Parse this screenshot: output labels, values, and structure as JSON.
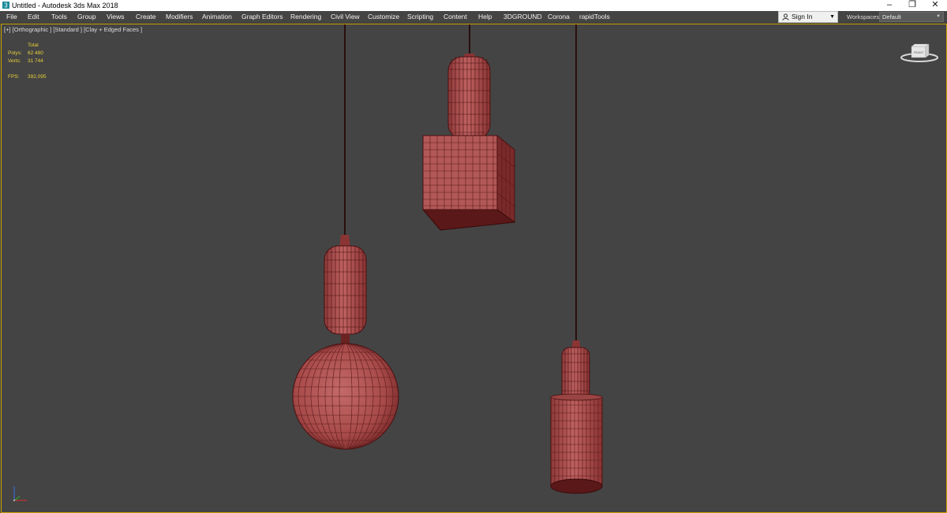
{
  "window": {
    "title": "Untitled - Autodesk 3ds Max 2018",
    "buttons": [
      "–",
      "❐",
      "✕"
    ]
  },
  "menu": {
    "items": [
      "File",
      "Edit",
      "Tools",
      "Group",
      "Views",
      "Create",
      "Modifiers",
      "Animation",
      "Graph Editors",
      "Rendering",
      "Civil View",
      "Customize",
      "Scripting",
      "Content",
      "Help",
      "3DGROUND",
      "Corona",
      "rapidTools"
    ]
  },
  "account": {
    "sign_in_label": "Sign In",
    "icon": "user-icon"
  },
  "workspaces": {
    "label": "Workspaces:",
    "value": "Default"
  },
  "viewport": {
    "label": "[+] [Orthographic ] [Standard ] [Clay + Edged Faces ]",
    "stats": {
      "header": "Total",
      "polys_label": "Polys:",
      "polys_value": "62 480",
      "verts_label": "Verts:",
      "verts_value": "31 744",
      "fps_label": "FPS:",
      "fps_value": "392,095"
    },
    "viewcube": {
      "face_label": "FRONT",
      "icon": "viewcube-icon"
    },
    "axis": {
      "icon": "axis-tripod-icon"
    },
    "colors": {
      "background": "#444444",
      "active_border": "#c8a400",
      "model_fill": "#b25858",
      "wire": "#5a1a1a",
      "stats_text": "#e8d03a"
    }
  }
}
